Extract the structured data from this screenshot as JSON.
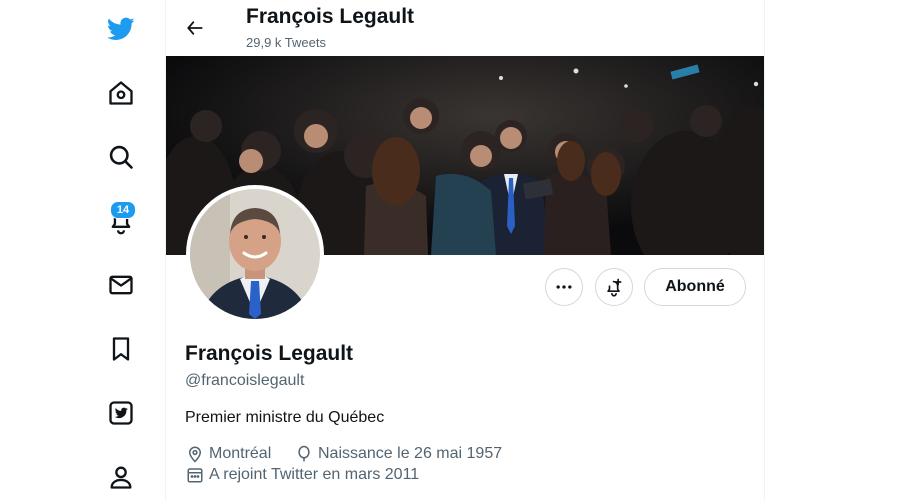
{
  "nav": {
    "notifications_badge": "14",
    "items": [
      {
        "name": "twitter-logo",
        "icon": "bird-icon"
      },
      {
        "name": "home",
        "icon": "home-icon"
      },
      {
        "name": "explore",
        "icon": "search-icon"
      },
      {
        "name": "notifications",
        "icon": "bell-icon"
      },
      {
        "name": "messages",
        "icon": "envelope-icon"
      },
      {
        "name": "bookmarks",
        "icon": "bookmark-icon"
      },
      {
        "name": "twitter-blue",
        "icon": "twitter-blue-icon"
      },
      {
        "name": "profile",
        "icon": "person-icon"
      }
    ]
  },
  "header": {
    "name": "François Legault",
    "tweet_count": "29,9 k Tweets"
  },
  "profile": {
    "name": "François Legault",
    "handle": "@francoislegault",
    "bio": "Premier ministre du Québec",
    "location": "Montréal",
    "birthday": "Naissance le 26 mai 1957",
    "joined": "A rejoint Twitter en mars 2011",
    "follow_button_label": "Abonné"
  },
  "colors": {
    "accent": "#1d9bf0",
    "text": "#0f1419",
    "secondary_text": "#536471",
    "border": "#cfd9de"
  }
}
